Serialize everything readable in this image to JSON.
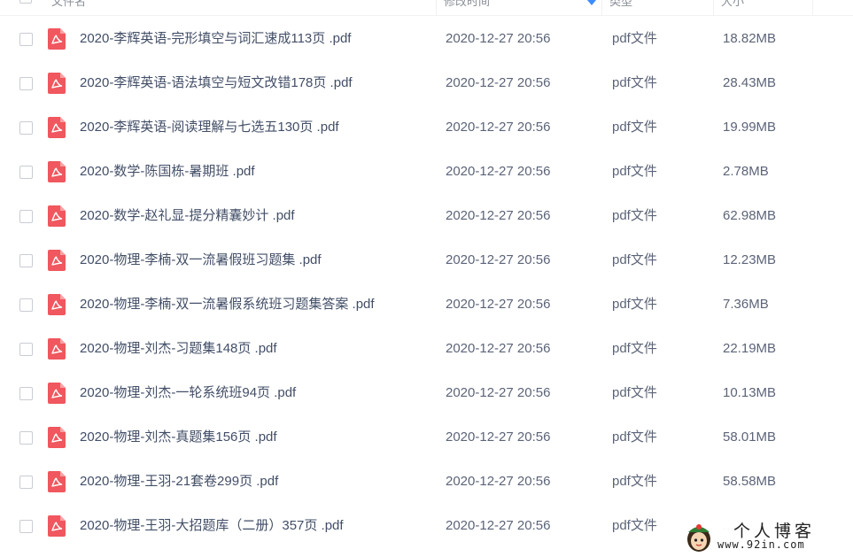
{
  "header": {
    "name": "文件名",
    "date": "修改时间",
    "type": "类型",
    "size": "大小"
  },
  "files": [
    {
      "name": "2020-李辉英语-完形填空与词汇速成113页 .pdf",
      "date": "2020-12-27 20:56",
      "type": "pdf文件",
      "size": "18.82MB"
    },
    {
      "name": "2020-李辉英语-语法填空与短文改错178页 .pdf",
      "date": "2020-12-27 20:56",
      "type": "pdf文件",
      "size": "28.43MB"
    },
    {
      "name": "2020-李辉英语-阅读理解与七选五130页 .pdf",
      "date": "2020-12-27 20:56",
      "type": "pdf文件",
      "size": "19.99MB"
    },
    {
      "name": "2020-数学-陈国栋-暑期班 .pdf",
      "date": "2020-12-27 20:56",
      "type": "pdf文件",
      "size": "2.78MB"
    },
    {
      "name": "2020-数学-赵礼显-提分精囊妙计 .pdf",
      "date": "2020-12-27 20:56",
      "type": "pdf文件",
      "size": "62.98MB"
    },
    {
      "name": "2020-物理-李楠-双一流暑假班习题集 .pdf",
      "date": "2020-12-27 20:56",
      "type": "pdf文件",
      "size": "12.23MB"
    },
    {
      "name": "2020-物理-李楠-双一流暑假系统班习题集答案 .pdf",
      "date": "2020-12-27 20:56",
      "type": "pdf文件",
      "size": "7.36MB"
    },
    {
      "name": "2020-物理-刘杰-习题集148页 .pdf",
      "date": "2020-12-27 20:56",
      "type": "pdf文件",
      "size": "22.19MB"
    },
    {
      "name": "2020-物理-刘杰-一轮系统班94页 .pdf",
      "date": "2020-12-27 20:56",
      "type": "pdf文件",
      "size": "10.13MB"
    },
    {
      "name": "2020-物理-刘杰-真题集156页 .pdf",
      "date": "2020-12-27 20:56",
      "type": "pdf文件",
      "size": "58.01MB"
    },
    {
      "name": "2020-物理-王羽-21套卷299页 .pdf",
      "date": "2020-12-27 20:56",
      "type": "pdf文件",
      "size": "58.58MB"
    },
    {
      "name": "2020-物理-王羽-大招题库（二册）357页 .pdf",
      "date": "2020-12-27 20:56",
      "type": "pdf文件",
      "size": "..."
    }
  ],
  "watermark": {
    "title": "个人博客",
    "url": "www.92in.com"
  },
  "colors": {
    "pdf_icon": "#f0575e",
    "sort_accent": "#3b8cff",
    "text_primary": "#424e67"
  },
  "icons": {
    "file": "pdf-icon",
    "sort": "sort-descending-icon",
    "checkbox": "checkbox-icon"
  }
}
